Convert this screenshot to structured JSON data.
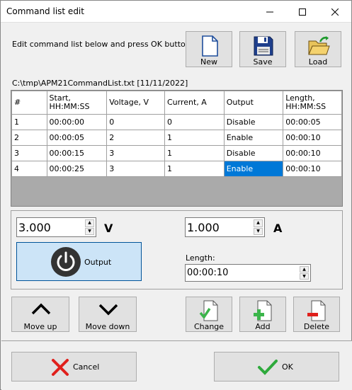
{
  "window": {
    "title": "Command list edit"
  },
  "instructions": "Edit command list below and press OK button:",
  "toolbar": {
    "new_label": "New",
    "save_label": "Save",
    "load_label": "Load"
  },
  "file_path": "C:\\tmp\\APM21CommandList.txt [11/11/2022]",
  "table": {
    "headers": [
      "#",
      "Start,\nHH:MM:SS",
      "Voltage, V",
      "Current, A",
      "Output",
      "Length,\nHH:MM:SS"
    ],
    "rows": [
      [
        "1",
        "00:00:00",
        "0",
        "0",
        "Disable",
        "00:00:05"
      ],
      [
        "2",
        "00:00:05",
        "2",
        "1",
        "Enable",
        "00:00:10"
      ],
      [
        "3",
        "00:00:15",
        "3",
        "1",
        "Disable",
        "00:00:10"
      ],
      [
        "4",
        "00:00:25",
        "3",
        "1",
        "Enable",
        "00:00:10"
      ]
    ],
    "selected_row": 3,
    "selected_col": 4
  },
  "editor": {
    "voltage_value": "3.000",
    "voltage_unit": "V",
    "current_value": "1.000",
    "current_unit": "A",
    "output_label": "Output",
    "length_label": "Length:",
    "length_value": "00:00:10"
  },
  "actions": {
    "move_up": "Move up",
    "move_down": "Move down",
    "change": "Change",
    "add": "Add",
    "delete": "Delete"
  },
  "dialog": {
    "cancel_label": "Cancel",
    "ok_label": "OK"
  },
  "colors": {
    "selection": "#0078d7",
    "output_button_bg": "#cce4f7",
    "cancel_red": "#e0201c",
    "ok_green": "#2eaa3c"
  }
}
